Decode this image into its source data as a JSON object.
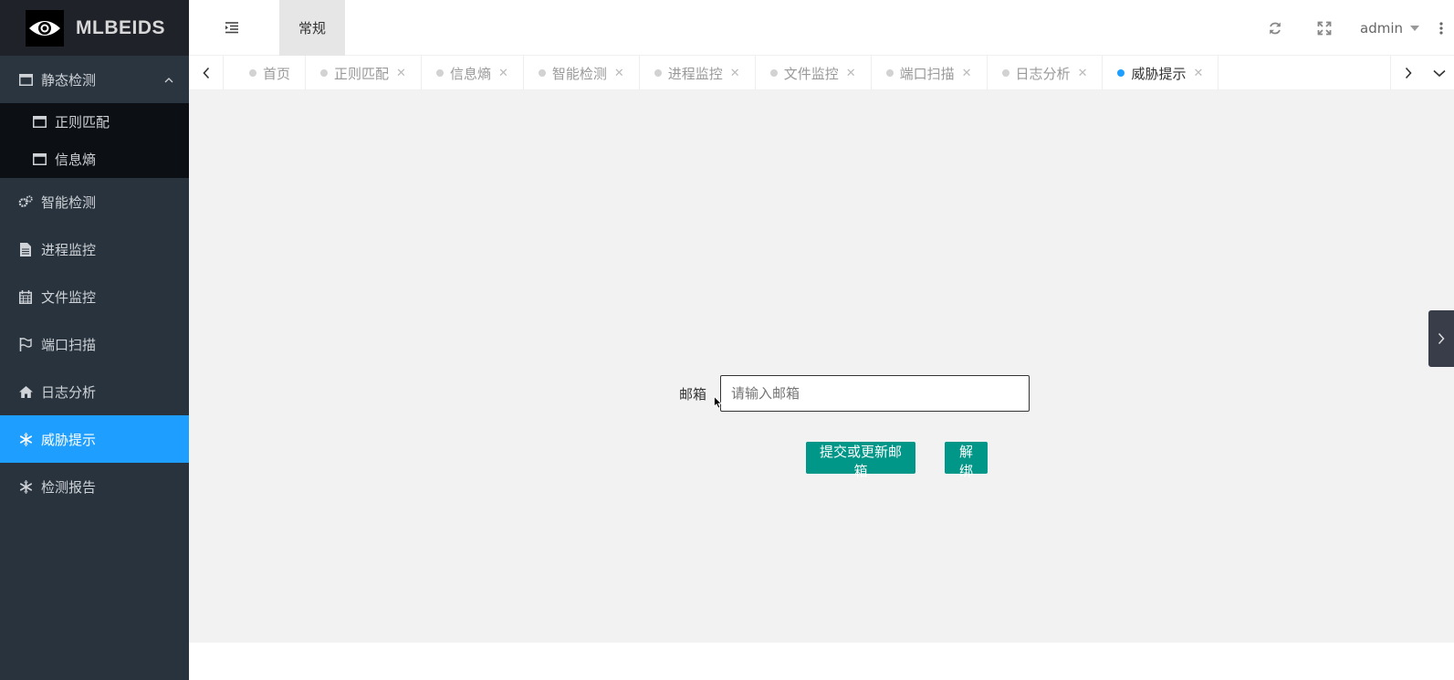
{
  "app": {
    "logo_text": "MLBEIDS"
  },
  "header": {
    "tab_label": "常规",
    "user": "admin"
  },
  "sidebar": {
    "group": {
      "label": "静态检测",
      "children": [
        {
          "label": "正则匹配"
        },
        {
          "label": "信息熵"
        }
      ]
    },
    "items": [
      {
        "label": "智能检测",
        "icon": "gears-icon"
      },
      {
        "label": "进程监控",
        "icon": "file-icon"
      },
      {
        "label": "文件监控",
        "icon": "calendar-icon"
      },
      {
        "label": "端口扫描",
        "icon": "flag-icon"
      },
      {
        "label": "日志分析",
        "icon": "home-icon"
      },
      {
        "label": "威胁提示",
        "icon": "snowflake-icon",
        "active": true
      },
      {
        "label": "检测报告",
        "icon": "snowflake-icon"
      }
    ]
  },
  "tabs": [
    {
      "label": "首页",
      "closable": false
    },
    {
      "label": "正则匹配",
      "closable": true
    },
    {
      "label": "信息熵",
      "closable": true
    },
    {
      "label": "智能检测",
      "closable": true
    },
    {
      "label": "进程监控",
      "closable": true
    },
    {
      "label": "文件监控",
      "closable": true
    },
    {
      "label": "端口扫描",
      "closable": true
    },
    {
      "label": "日志分析",
      "closable": true
    },
    {
      "label": "威胁提示",
      "closable": true,
      "active": true
    }
  ],
  "form": {
    "email_label": "邮箱",
    "email_placeholder": "请输入邮箱",
    "email_value": "",
    "submit_label": "提交或更新邮箱",
    "unbind_label": "解绑"
  },
  "colors": {
    "accent": "#1e9fff",
    "button": "#009688",
    "sidebar_bg": "#28333e"
  }
}
